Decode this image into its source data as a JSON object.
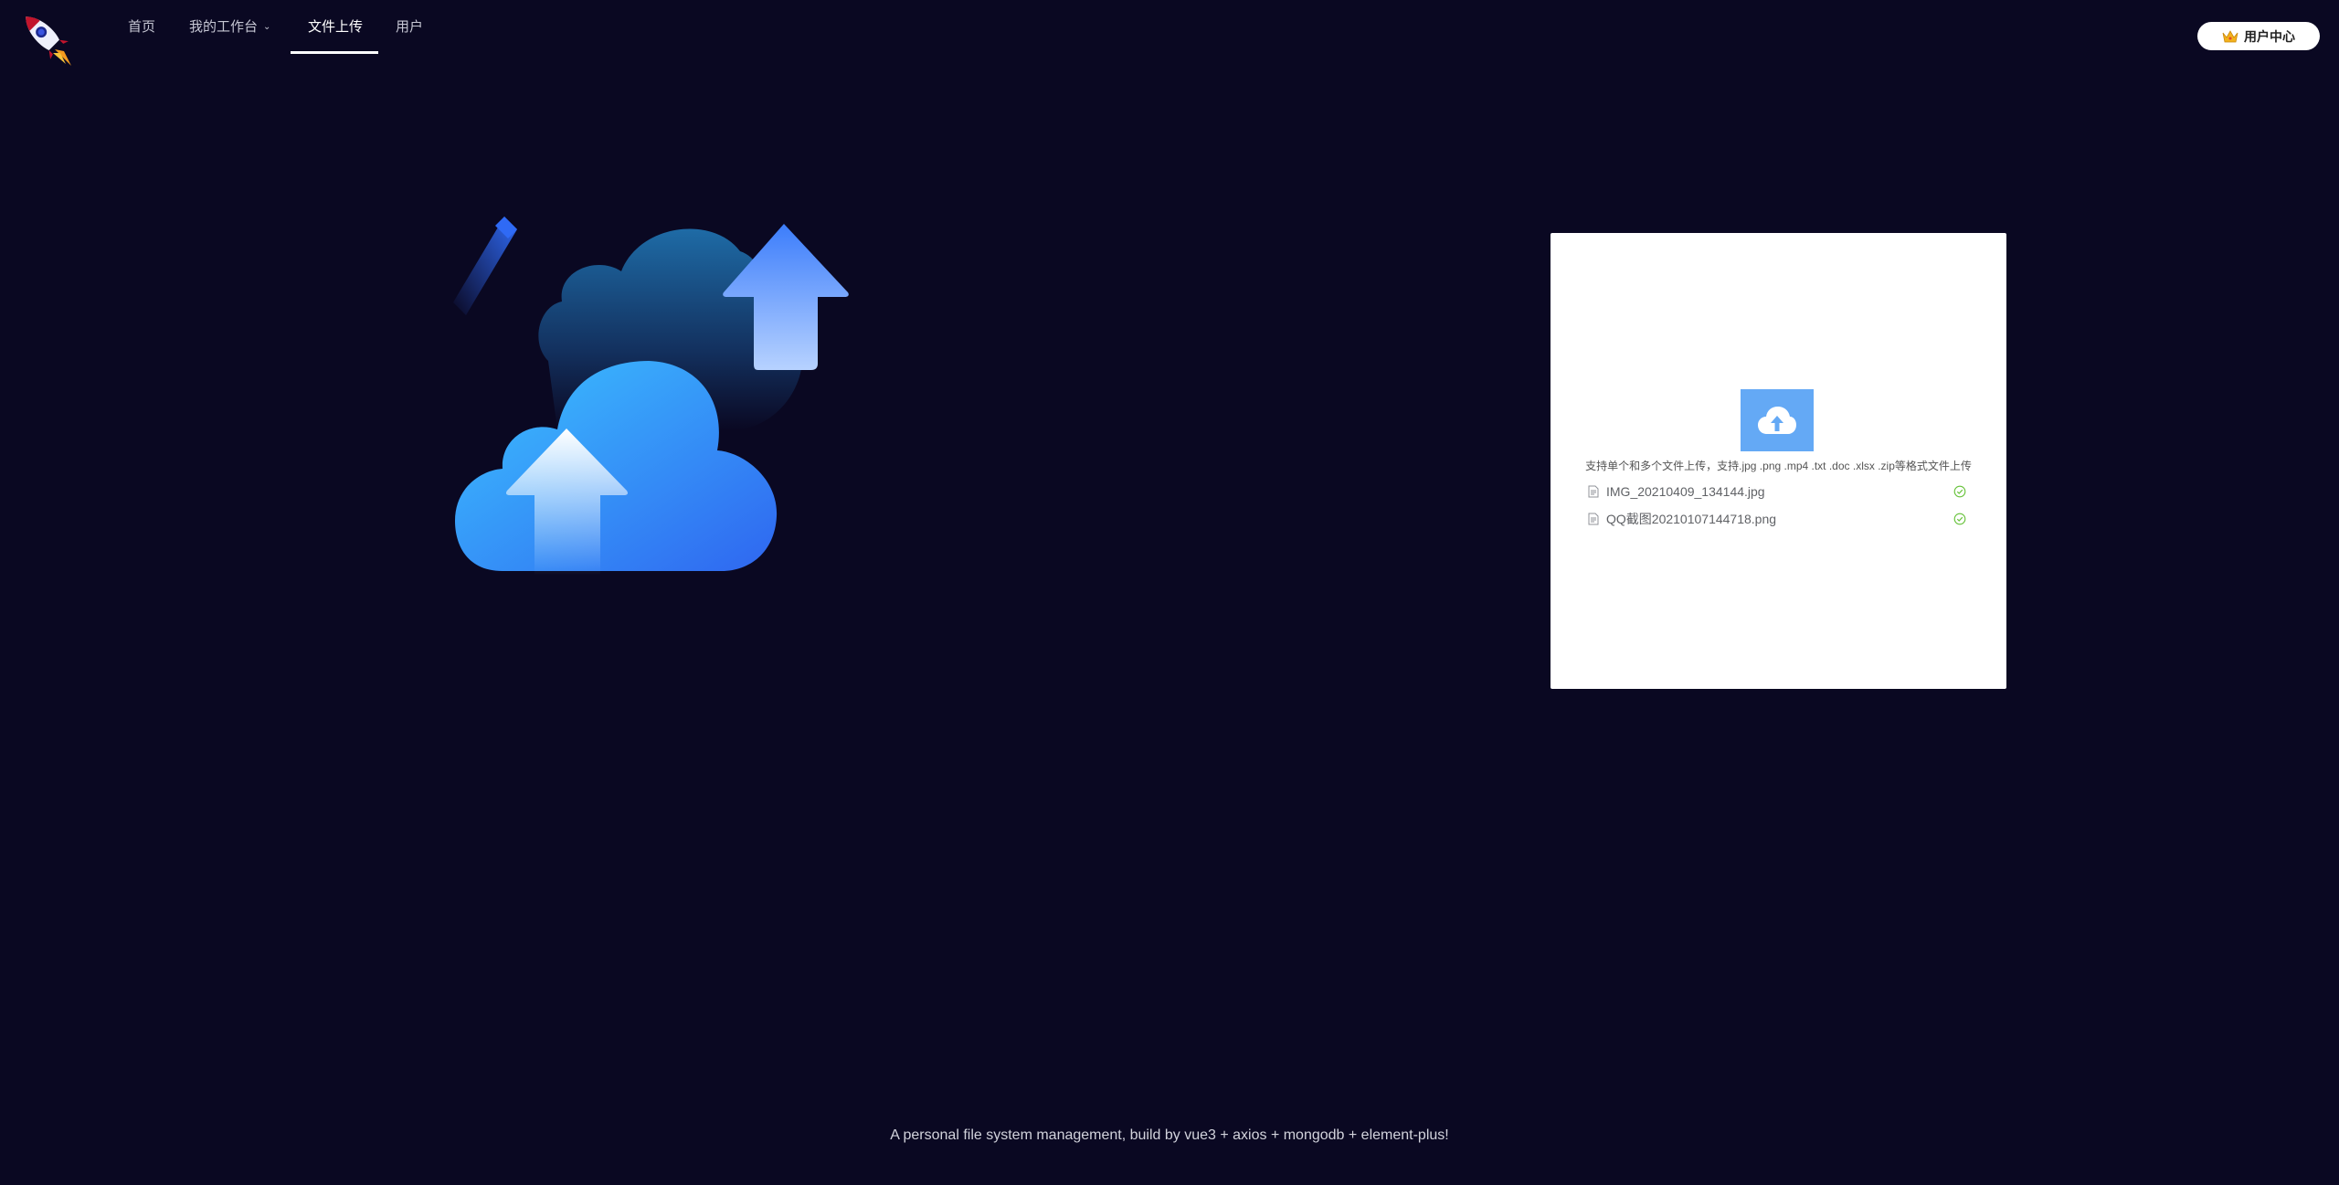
{
  "nav": {
    "items": [
      {
        "label": "首页"
      },
      {
        "label": "我的工作台"
      },
      {
        "label": "文件上传"
      },
      {
        "label": "用户"
      }
    ],
    "active_index": 2
  },
  "header": {
    "user_center_label": "用户中心",
    "logo_icon": "rocket-icon"
  },
  "upload": {
    "tip": "支持单个和多个文件上传，支持.jpg .png .mp4 .txt .doc .xlsx .zip等格式文件上传",
    "files": [
      {
        "name": "IMG_20210409_134144.jpg",
        "status": "success"
      },
      {
        "name": "QQ截图20210107144718.png",
        "status": "success"
      }
    ]
  },
  "footer": {
    "text": "A personal file system management, build by vue3 + axios + mongodb + element-plus!"
  },
  "colors": {
    "background": "#0a0822",
    "upload_button": "#64a9f5",
    "success": "#67c23a"
  }
}
